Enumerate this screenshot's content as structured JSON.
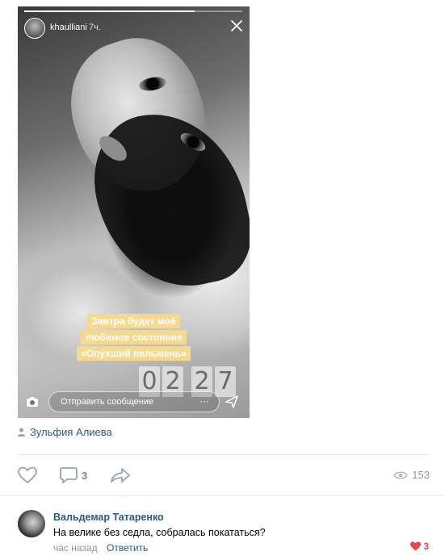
{
  "story": {
    "username": "khaulliani",
    "time_ago": "7ч.",
    "progress": 0.78,
    "caption_lines": [
      "Завтра будет моё",
      "любимое состояние",
      "«Опухший пельмень»"
    ],
    "clock": [
      "0",
      "2",
      "2",
      "7"
    ],
    "message_placeholder": "Отправить сообщение",
    "message_more": "···",
    "caption_color": "#f4d98e"
  },
  "post": {
    "author": "Зульфия Алиева",
    "comments_count": "3",
    "views_count": "153"
  },
  "comment": {
    "author": "Вальдемар Татаренко",
    "text": "На велике без седла, собралась покататься?",
    "time": "час назад",
    "reply_label": "Ответить",
    "likes": "3",
    "like_color": "#e64646",
    "link_color": "#2a5885"
  }
}
